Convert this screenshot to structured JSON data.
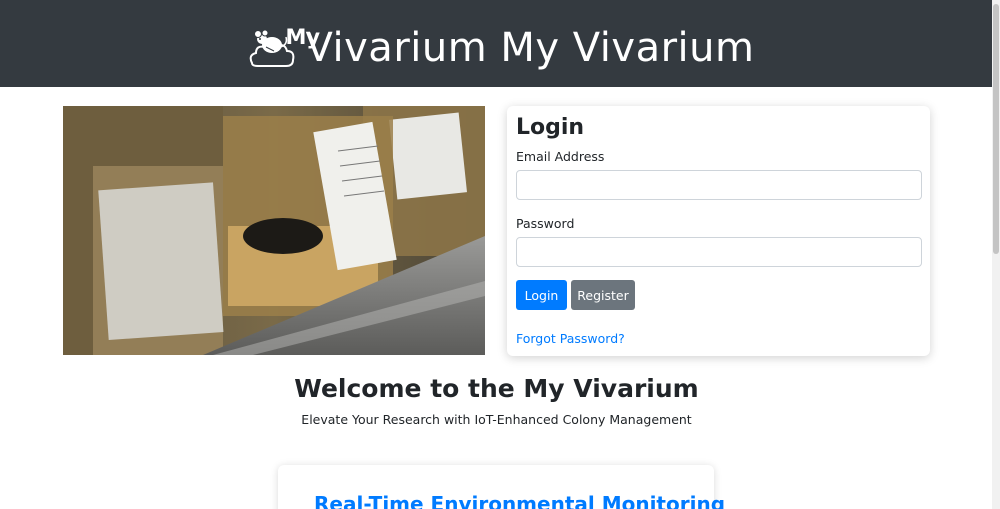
{
  "header": {
    "logo_small": "My",
    "title": "Vivarium My Vivarium"
  },
  "hero": {
    "icon": "lab-cage-photo"
  },
  "login": {
    "title": "Login",
    "email_label": "Email Address",
    "email_value": "",
    "password_label": "Password",
    "password_value": "",
    "login_button": "Login",
    "register_button": "Register",
    "forgot_link": "Forgot Password?"
  },
  "welcome": {
    "heading": "Welcome to the My Vivarium",
    "tagline": "Elevate Your Research with IoT-Enhanced Colony Management"
  },
  "feature": {
    "title": "Real-Time Environmental Monitoring"
  },
  "colors": {
    "header_bg": "#343a40",
    "primary": "#007bff",
    "secondary": "#6c757d"
  }
}
